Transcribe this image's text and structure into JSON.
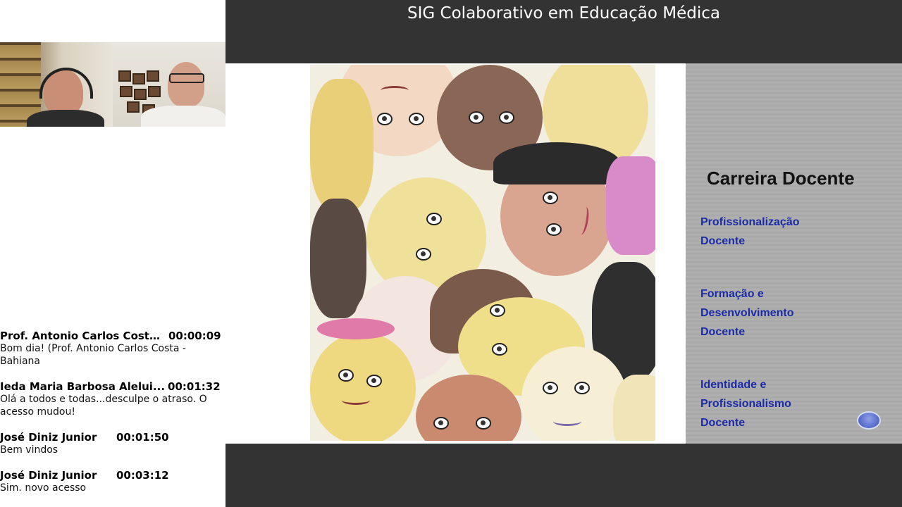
{
  "header": {
    "title": "SIG Colaborativo em Educação Médica"
  },
  "chat": {
    "messages": [
      {
        "name": "Prof. Antonio Carlos Costa...",
        "time": "00:00:09",
        "text": "Bom dia! (Prof. Antonio Carlos Costa - Bahiana"
      },
      {
        "name": "Ieda Maria Barbosa Alelui...",
        "time": "00:01:32",
        "text": "Olá a todos e todas...desculpe o atraso. O acesso mudou!"
      },
      {
        "name": "José Diniz Junior",
        "time": "00:01:50",
        "text": "Bem vindos"
      },
      {
        "name": "José Diniz Junior",
        "time": "00:03:12",
        "text": "Sim. novo acesso"
      }
    ]
  },
  "slide": {
    "heading": "Carreira Docente",
    "items": [
      {
        "line1": "Profissionalização",
        "line2": "Docente"
      },
      {
        "line1": "Formação e",
        "line2": "Desenvolvimento",
        "line3": "Docente"
      },
      {
        "line1": "Identidade e",
        "line2": "Profissionalismo",
        "line3": "Docente"
      }
    ],
    "link_color": "#1a2aa8"
  },
  "icons": {
    "nav": "circle-nav-button"
  }
}
